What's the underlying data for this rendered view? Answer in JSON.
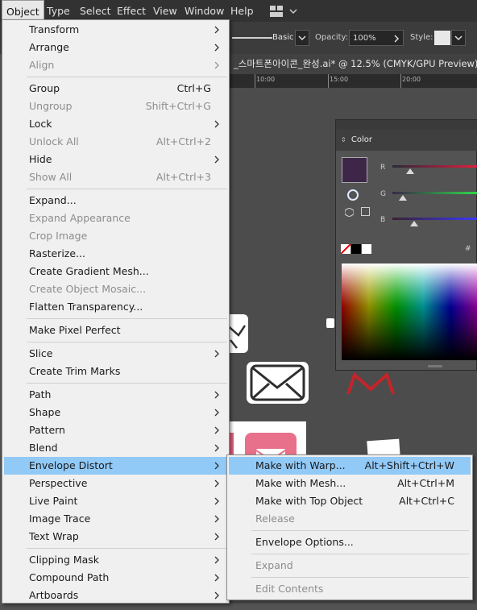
{
  "menubar": {
    "items": [
      "Object",
      "Type",
      "Select",
      "Effect",
      "View",
      "Window",
      "Help"
    ],
    "active": "Object"
  },
  "controlbar": {
    "stroke_style": "Basic",
    "opacity_label": "Opacity:",
    "opacity_value": "100%",
    "style_label": "Style:"
  },
  "document": {
    "tab_title": "_스마트폰아이콘_완성.ai* @ 12.5% (CMYK/GPU Preview)",
    "ruler_ticks": [
      "10:00",
      "15:00",
      "20:00"
    ]
  },
  "color_panel": {
    "title": "Color",
    "fill_color": "#3d2648",
    "sliders": [
      "R",
      "G",
      "B"
    ],
    "hex_prefix": "#"
  },
  "object_menu": {
    "items": [
      {
        "label": "Transform",
        "shortcut": "",
        "submenu": true,
        "enabled": true
      },
      {
        "label": "Arrange",
        "shortcut": "",
        "submenu": true,
        "enabled": true
      },
      {
        "label": "Align",
        "shortcut": "",
        "submenu": true,
        "enabled": false
      },
      {
        "sep": true
      },
      {
        "label": "Group",
        "shortcut": "Ctrl+G",
        "submenu": false,
        "enabled": true
      },
      {
        "label": "Ungroup",
        "shortcut": "Shift+Ctrl+G",
        "submenu": false,
        "enabled": false
      },
      {
        "label": "Lock",
        "shortcut": "",
        "submenu": true,
        "enabled": true
      },
      {
        "label": "Unlock All",
        "shortcut": "Alt+Ctrl+2",
        "submenu": false,
        "enabled": false
      },
      {
        "label": "Hide",
        "shortcut": "",
        "submenu": true,
        "enabled": true
      },
      {
        "label": "Show All",
        "shortcut": "Alt+Ctrl+3",
        "submenu": false,
        "enabled": false
      },
      {
        "sep": true
      },
      {
        "label": "Expand...",
        "shortcut": "",
        "submenu": false,
        "enabled": true
      },
      {
        "label": "Expand Appearance",
        "shortcut": "",
        "submenu": false,
        "enabled": false
      },
      {
        "label": "Crop Image",
        "shortcut": "",
        "submenu": false,
        "enabled": false
      },
      {
        "label": "Rasterize...",
        "shortcut": "",
        "submenu": false,
        "enabled": true
      },
      {
        "label": "Create Gradient Mesh...",
        "shortcut": "",
        "submenu": false,
        "enabled": true
      },
      {
        "label": "Create Object Mosaic...",
        "shortcut": "",
        "submenu": false,
        "enabled": false
      },
      {
        "label": "Flatten Transparency...",
        "shortcut": "",
        "submenu": false,
        "enabled": true
      },
      {
        "sep": true
      },
      {
        "label": "Make Pixel Perfect",
        "shortcut": "",
        "submenu": false,
        "enabled": true
      },
      {
        "sep": true
      },
      {
        "label": "Slice",
        "shortcut": "",
        "submenu": true,
        "enabled": true
      },
      {
        "label": "Create Trim Marks",
        "shortcut": "",
        "submenu": false,
        "enabled": true
      },
      {
        "sep": true
      },
      {
        "label": "Path",
        "shortcut": "",
        "submenu": true,
        "enabled": true
      },
      {
        "label": "Shape",
        "shortcut": "",
        "submenu": true,
        "enabled": true
      },
      {
        "label": "Pattern",
        "shortcut": "",
        "submenu": true,
        "enabled": true
      },
      {
        "label": "Blend",
        "shortcut": "",
        "submenu": true,
        "enabled": true
      },
      {
        "label": "Envelope Distort",
        "shortcut": "",
        "submenu": true,
        "enabled": true,
        "highlighted": true
      },
      {
        "label": "Perspective",
        "shortcut": "",
        "submenu": true,
        "enabled": true
      },
      {
        "label": "Live Paint",
        "shortcut": "",
        "submenu": true,
        "enabled": true
      },
      {
        "label": "Image Trace",
        "shortcut": "",
        "submenu": true,
        "enabled": true
      },
      {
        "label": "Text Wrap",
        "shortcut": "",
        "submenu": true,
        "enabled": true
      },
      {
        "sep": true
      },
      {
        "label": "Clipping Mask",
        "shortcut": "",
        "submenu": true,
        "enabled": true
      },
      {
        "label": "Compound Path",
        "shortcut": "",
        "submenu": true,
        "enabled": true
      },
      {
        "label": "Artboards",
        "shortcut": "",
        "submenu": true,
        "enabled": true
      }
    ]
  },
  "envelope_submenu": {
    "items": [
      {
        "label": "Make with Warp...",
        "shortcut": "Alt+Shift+Ctrl+W",
        "enabled": true,
        "highlighted": true
      },
      {
        "label": "Make with Mesh...",
        "shortcut": "Alt+Ctrl+M",
        "enabled": true
      },
      {
        "label": "Make with Top Object",
        "shortcut": "Alt+Ctrl+C",
        "enabled": true
      },
      {
        "label": "Release",
        "shortcut": "",
        "enabled": false
      },
      {
        "sep": true
      },
      {
        "label": "Envelope Options...",
        "shortcut": "",
        "enabled": true
      },
      {
        "sep": true
      },
      {
        "label": "Expand",
        "shortcut": "",
        "enabled": false
      },
      {
        "sep": true
      },
      {
        "label": "Edit Contents",
        "shortcut": "",
        "enabled": false
      }
    ]
  },
  "icons": [
    "workspace-switcher-icon",
    "chevron-down-icon",
    "chevron-right-icon",
    "mail-icon"
  ],
  "colors": {
    "highlight": "#91c9f7",
    "menu_bg": "#f0f0f0",
    "accent_red": "#c4242a"
  }
}
